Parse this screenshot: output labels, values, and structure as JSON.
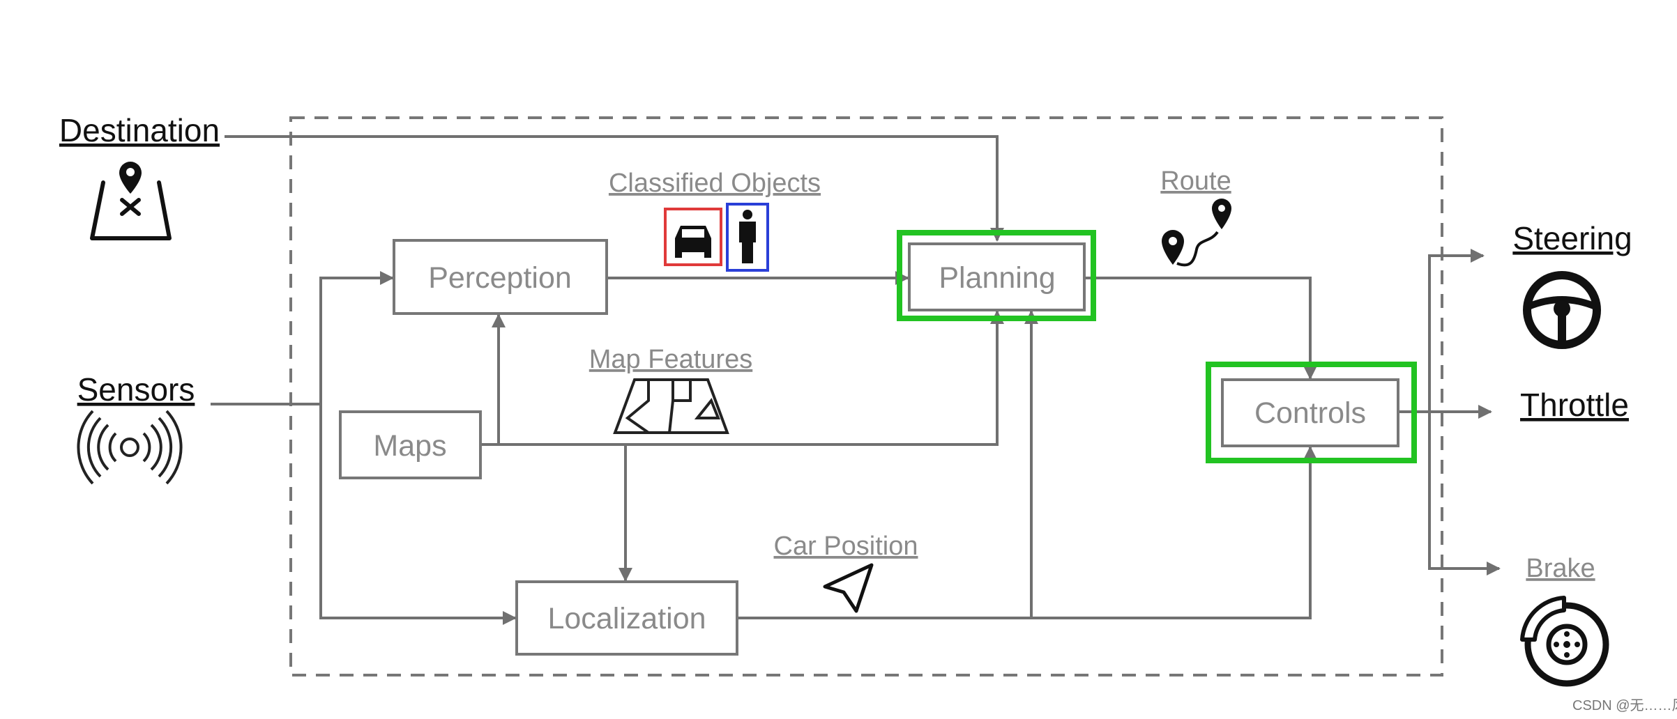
{
  "inputs": {
    "destination": "Destination",
    "sensors": "Sensors"
  },
  "modules": {
    "perception": "Perception",
    "maps": "Maps",
    "planning": "Planning",
    "localization": "Localization",
    "controls": "Controls"
  },
  "annotations": {
    "classified_objects": "Classified Objects",
    "map_features": "Map Features",
    "route": "Route",
    "car_position": "Car Position"
  },
  "outputs": {
    "steering": "Steering",
    "throttle": "Throttle",
    "brake": "Brake"
  },
  "highlight_color": "#22c322",
  "car_box_color": "#e03a3a",
  "person_box_color": "#2a3fd8",
  "watermark": "CSDN @无……风"
}
